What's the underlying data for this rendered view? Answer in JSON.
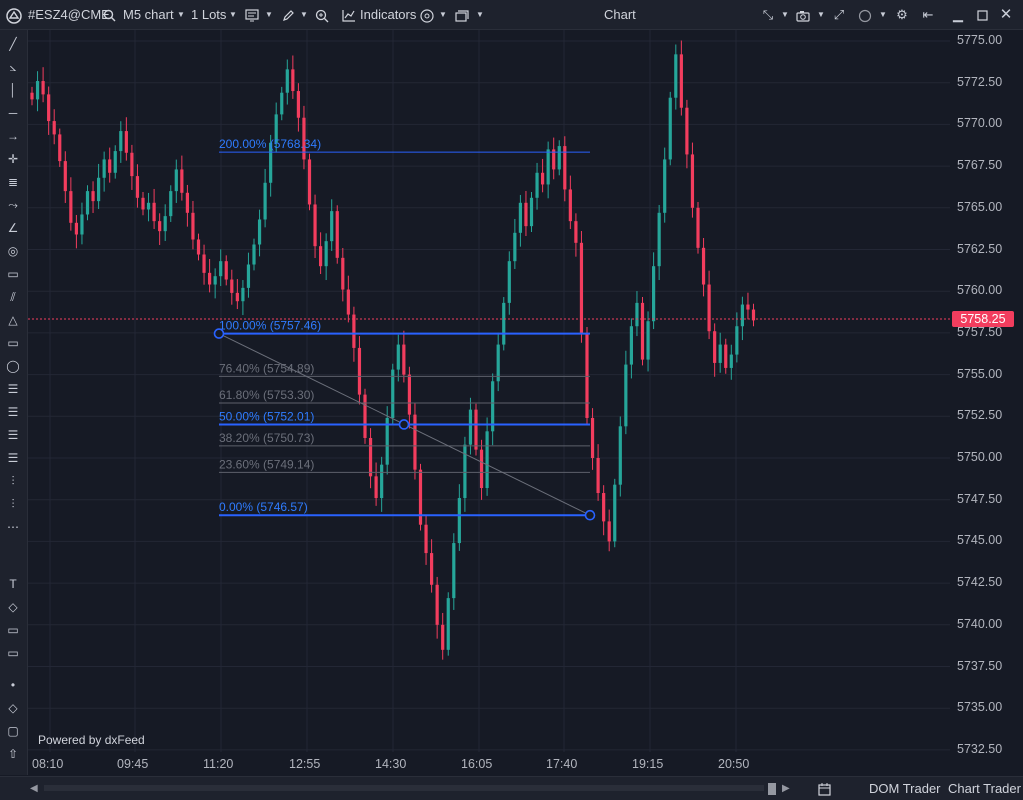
{
  "topbar": {
    "symbol": "#ESZ4@CME",
    "timeframe": "M5 chart",
    "lots": "1 Lots",
    "indicators_label": "Indicators",
    "window_title": "Chart"
  },
  "price": {
    "current": "5758.25",
    "current_value": 5758.25,
    "color_up": "#26a69a",
    "color_down": "#f23d5e"
  },
  "axis": {
    "y_labels": [
      "5775.00",
      "5772.50",
      "5770.00",
      "5767.50",
      "5765.00",
      "5762.50",
      "5760.00",
      "5757.50",
      "5755.00",
      "5752.50",
      "5750.00",
      "5747.50",
      "5745.00",
      "5742.50",
      "5740.00",
      "5737.50",
      "5735.00",
      "5732.50"
    ],
    "x_labels": [
      "08:10",
      "09:45",
      "11:20",
      "12:55",
      "14:30",
      "16:05",
      "17:40",
      "19:15",
      "20:50"
    ]
  },
  "fibonacci": {
    "levels": [
      {
        "label": "200.00% (5768.34)",
        "price": 5768.34,
        "major": true
      },
      {
        "label": "100.00% (5757.46)",
        "price": 5757.46,
        "major": true
      },
      {
        "label": "76.40% (5754.89)",
        "price": 5754.89,
        "major": false
      },
      {
        "label": "61.80% (5753.30)",
        "price": 5753.3,
        "major": false
      },
      {
        "label": "50.00% (5752.01)",
        "price": 5752.01,
        "major": true
      },
      {
        "label": "38.20% (5750.73)",
        "price": 5750.73,
        "major": false
      },
      {
        "label": "23.60% (5749.14)",
        "price": 5749.14,
        "major": false
      },
      {
        "label": "0.00% (5746.57)",
        "price": 5746.57,
        "major": true
      }
    ]
  },
  "footer": {
    "powered_by": "Powered by dxFeed",
    "dom_trader": "DOM Trader",
    "chart_trader": "Chart Trader"
  },
  "toolbar_icons": [
    "line-icon",
    "angle-icon",
    "vertical-line-icon",
    "horizontal-line-icon",
    "arrow-icon",
    "crosshair-icon",
    "pitchfork-icon",
    "curve-icon",
    "trend-angle-icon",
    "spiral-icon",
    "ruler-icon",
    "parallel-channel-icon",
    "triangle-icon",
    "rectangle-icon",
    "ellipse-icon",
    "fib-retracement-icon",
    "fib-extension-icon",
    "fib-fan-icon",
    "gann-icon",
    "regression-icon",
    "measure-icon",
    "dotted-line-icon",
    "text-icon",
    "tag-icon",
    "callout-icon",
    "label-icon",
    "dot-icon",
    "diamond-icon",
    "square-icon",
    "up-arrow-icon"
  ]
}
